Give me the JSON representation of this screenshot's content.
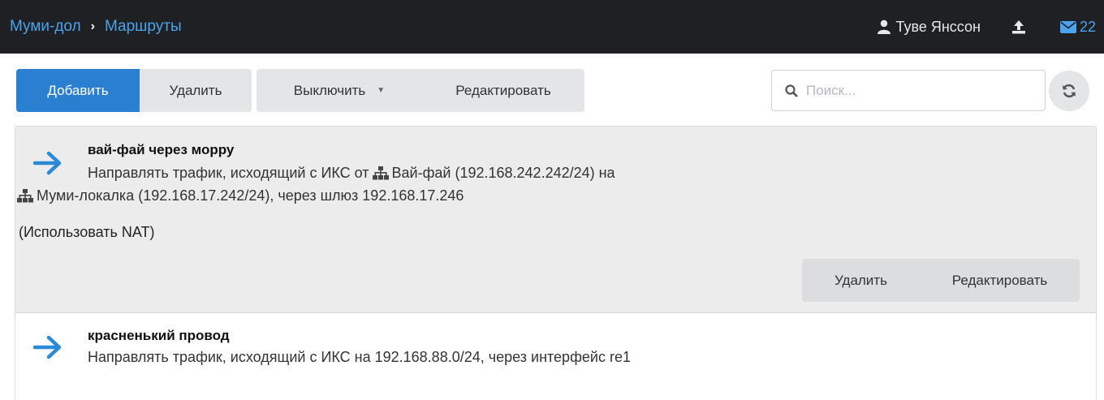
{
  "header": {
    "breadcrumb": [
      "Муми-дол",
      "Маршруты"
    ],
    "user_name": "Туве Янссон",
    "mail_count": "22"
  },
  "toolbar": {
    "add_label": "Добавить",
    "delete_label": "Удалить",
    "disable_label": "Выключить",
    "edit_label": "Редактировать"
  },
  "search": {
    "placeholder": "Поиск..."
  },
  "routes": [
    {
      "name": "вай-фай через морру",
      "desc_part1": "Направлять трафик, исходящий с ИКС от",
      "source_net": "Вай-фай (192.168.242.242/24) на",
      "dest_net": "Муми-локалка (192.168.17.242/24), через шлюз 192.168.17.246",
      "nat_note": "(Использовать NAT)",
      "delete_label": "Удалить",
      "edit_label": "Редактировать"
    },
    {
      "name": "красненький провод",
      "desc": "Направлять трафик, исходящий с ИКС на 192.168.88.0/24, через интерфейс re1"
    }
  ],
  "colors": {
    "accent": "#2b7fd1",
    "topbar": "#1f2023",
    "link": "#4aa3ee"
  }
}
